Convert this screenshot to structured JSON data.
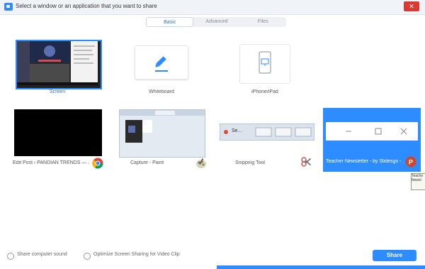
{
  "window": {
    "title": "Select a window or an application that you want to share",
    "close_label": "✕"
  },
  "tabs": [
    {
      "label": "Basic",
      "active": true
    },
    {
      "label": "Advanced",
      "active": false
    },
    {
      "label": "Files",
      "active": false
    }
  ],
  "tiles": {
    "screen": {
      "label": "Screen"
    },
    "whiteboard": {
      "label": "Whiteboard"
    },
    "iphone": {
      "label": "iPhone/iPad"
    },
    "chrome": {
      "label": "Edit Post ‹ PANDIAN TRENDS — ..."
    },
    "paint": {
      "label": "Capture - Paint"
    },
    "snipping": {
      "label": "Snipping Tool",
      "toolbar_text": "Se..."
    },
    "ppt": {
      "label": "Teacher Newsletter - by Slidesgo - ..."
    }
  },
  "tooltip": {
    "text": "Teache Newsl"
  },
  "footer": {
    "share_sound_label": "Share computer sound",
    "optimize_label": "Optimize Screen Sharing for Video Clip",
    "share_button": "Share"
  },
  "colors": {
    "accent": "#2d8cff",
    "close": "#d93b32"
  },
  "icons": {
    "whiteboard": "pencil-icon",
    "iphone": "phone-icon",
    "chrome": "chrome-icon",
    "paint": "paint-icon",
    "snipping": "scissors-icon",
    "ppt": "powerpoint-icon"
  }
}
